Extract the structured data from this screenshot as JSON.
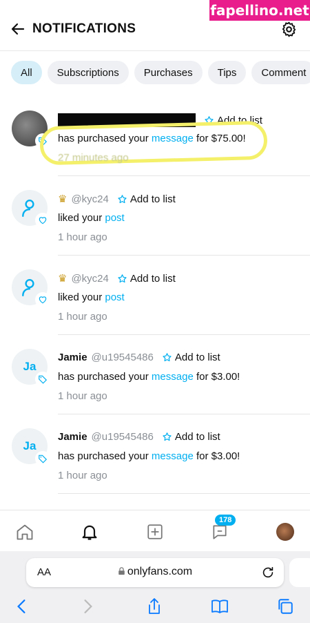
{
  "watermark": "fapellino.net",
  "header": {
    "title": "NOTIFICATIONS"
  },
  "filters": [
    "All",
    "Subscriptions",
    "Purchases",
    "Tips",
    "Comment"
  ],
  "notifications": [
    {
      "name": "",
      "handle": "",
      "add": "Add to list",
      "pre": "has purchased your ",
      "link": "message",
      "post": " for $75.00!",
      "time": "27 minutes ago",
      "avatar": "photo",
      "badge": "tag"
    },
    {
      "name": "",
      "handle": "@kyc24",
      "add": "Add to list",
      "pre": "liked your ",
      "link": "post",
      "post": "",
      "time": "1 hour ago",
      "avatar": "user",
      "badge": "heart"
    },
    {
      "name": "",
      "handle": "@kyc24",
      "add": "Add to list",
      "pre": "liked your ",
      "link": "post",
      "post": "",
      "time": "1 hour ago",
      "avatar": "user",
      "badge": "heart"
    },
    {
      "name": "Jamie",
      "handle": "@u19545486",
      "add": "Add to list",
      "pre": "has purchased your ",
      "link": "message",
      "post": " for $3.00!",
      "time": "1 hour ago",
      "avatar": "Ja",
      "badge": "tag"
    },
    {
      "name": "Jamie",
      "handle": "@u19545486",
      "add": "Add to list",
      "pre": "has purchased your ",
      "link": "message",
      "post": " for $3.00!",
      "time": "1 hour ago",
      "avatar": "Ja",
      "badge": "tag"
    }
  ],
  "tabbar": {
    "messages_count": "178"
  },
  "browser": {
    "aa": "AA",
    "url": "onlyfans.com"
  },
  "colors": {
    "accent": "#00aff0",
    "highlight": "#f4f06a"
  }
}
